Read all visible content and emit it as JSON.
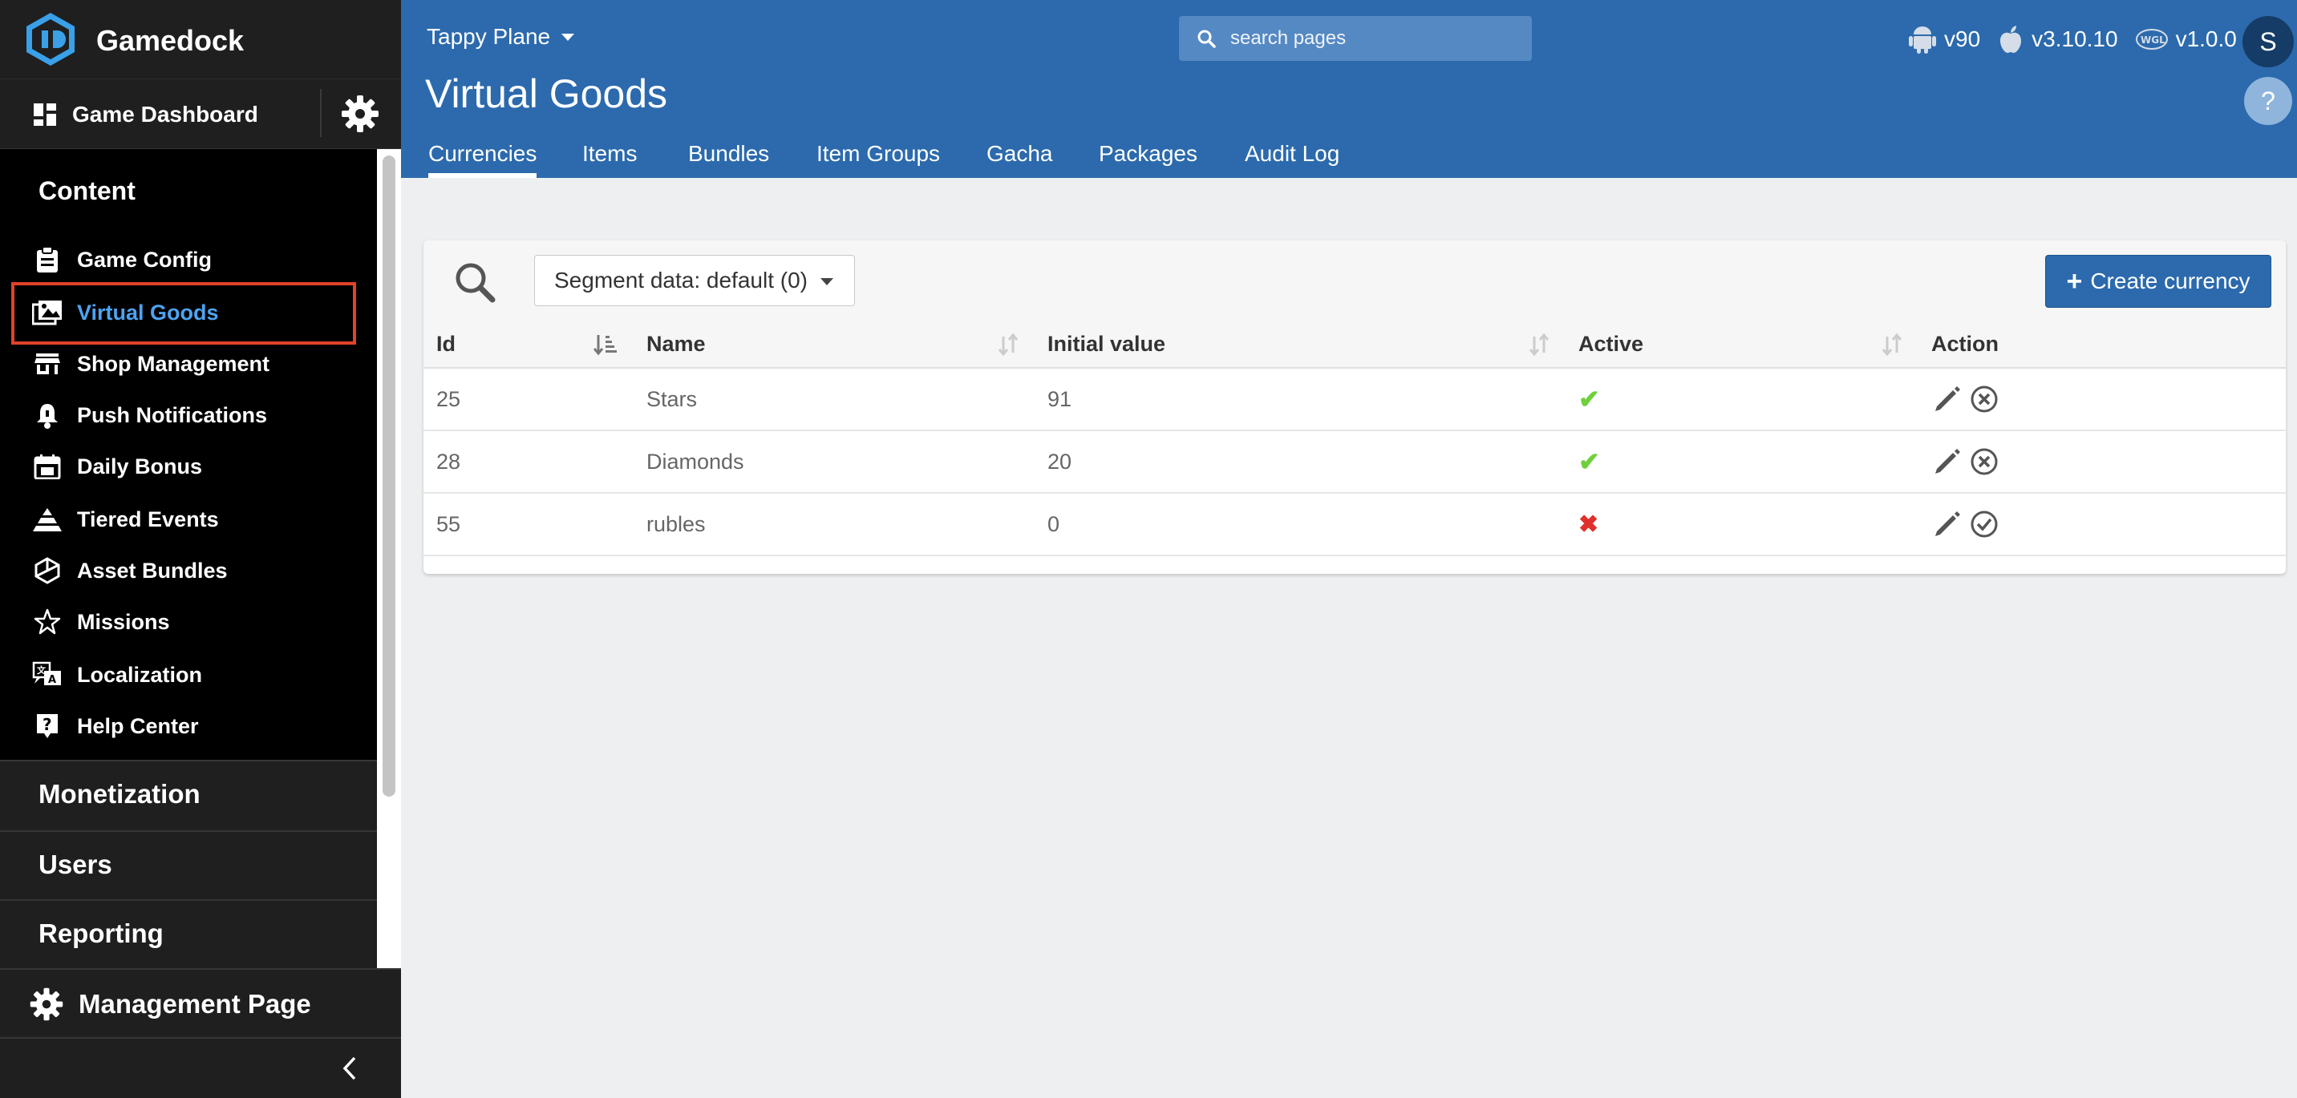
{
  "brand": {
    "name": "Gamedock"
  },
  "sidebar": {
    "dashboard_label": "Game Dashboard",
    "content_title": "Content",
    "items": [
      {
        "label": "Game Config",
        "icon": "clipboard-icon"
      },
      {
        "label": "Virtual Goods",
        "icon": "images-icon",
        "active": true
      },
      {
        "label": "Shop Management",
        "icon": "store-icon"
      },
      {
        "label": "Push Notifications",
        "icon": "bell-icon"
      },
      {
        "label": "Daily Bonus",
        "icon": "gift-calendar-icon"
      },
      {
        "label": "Tiered Events",
        "icon": "pyramid-icon"
      },
      {
        "label": "Asset Bundles",
        "icon": "unity-icon"
      },
      {
        "label": "Missions",
        "icon": "star-icon"
      },
      {
        "label": "Localization",
        "icon": "translate-icon"
      },
      {
        "label": "Help Center",
        "icon": "question-icon"
      }
    ],
    "sections": [
      "Monetization",
      "Users",
      "Reporting"
    ],
    "management_label": "Management Page"
  },
  "header": {
    "game": "Tappy Plane",
    "search_placeholder": "search pages",
    "versions": {
      "android": "v90",
      "ios": "v3.10.10",
      "webgl": "v1.0.0"
    },
    "avatar_initial": "S",
    "help_label": "?",
    "title": "Virtual Goods",
    "tabs": [
      "Currencies",
      "Items",
      "Bundles",
      "Item Groups",
      "Gacha",
      "Packages",
      "Audit Log"
    ],
    "active_tab": "Currencies"
  },
  "toolbar": {
    "segment_label": "Segment data: default (0)",
    "create_label": "Create currency"
  },
  "table": {
    "columns": [
      "Id",
      "Name",
      "Initial value",
      "Active",
      "Action"
    ],
    "rows": [
      {
        "id": "25",
        "name": "Stars",
        "initial": "91",
        "active": true
      },
      {
        "id": "28",
        "name": "Diamonds",
        "initial": "20",
        "active": true
      },
      {
        "id": "55",
        "name": "rubles",
        "initial": "0",
        "active": false
      }
    ]
  },
  "colors": {
    "header_blue": "#2c6aad",
    "active_link": "#4ea3f0",
    "highlight_border": "#e0432a",
    "check_green": "#6fd03c",
    "cross_red": "#e0302b"
  }
}
